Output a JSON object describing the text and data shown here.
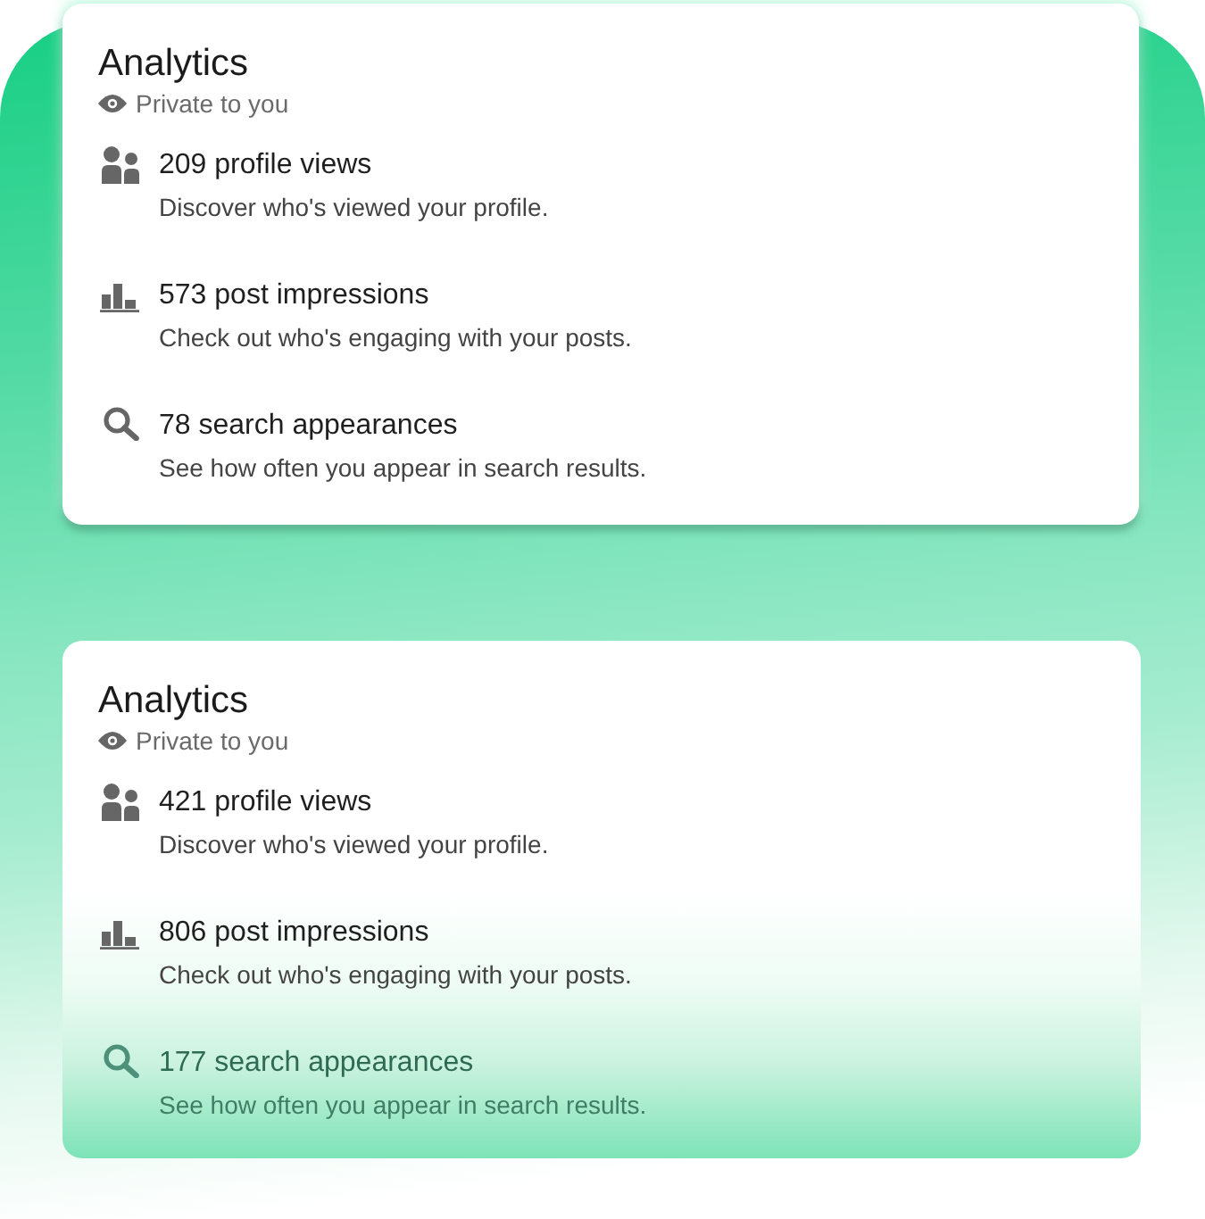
{
  "cards": [
    {
      "kind": "plain",
      "title": "Analytics",
      "privacy": "Private to you",
      "stats": [
        {
          "kind": "profile_views",
          "title": "209 profile views",
          "description": "Discover who's viewed your profile."
        },
        {
          "kind": "post_impressions",
          "title": "573 post impressions",
          "description": "Check out who's engaging with your posts."
        },
        {
          "kind": "search_appearances",
          "title": "78 search appearances",
          "description": "See how often you appear in search results."
        }
      ]
    },
    {
      "kind": "faded",
      "title": "Analytics",
      "privacy": "Private to you",
      "stats": [
        {
          "kind": "profile_views",
          "title": "421 profile views",
          "description": "Discover who's viewed your profile."
        },
        {
          "kind": "post_impressions",
          "title": "806 post impressions",
          "description": "Check out who's engaging with your posts."
        },
        {
          "kind": "search_appearances",
          "title": "177 search appearances",
          "description": "See how often you appear in search results."
        }
      ]
    }
  ]
}
